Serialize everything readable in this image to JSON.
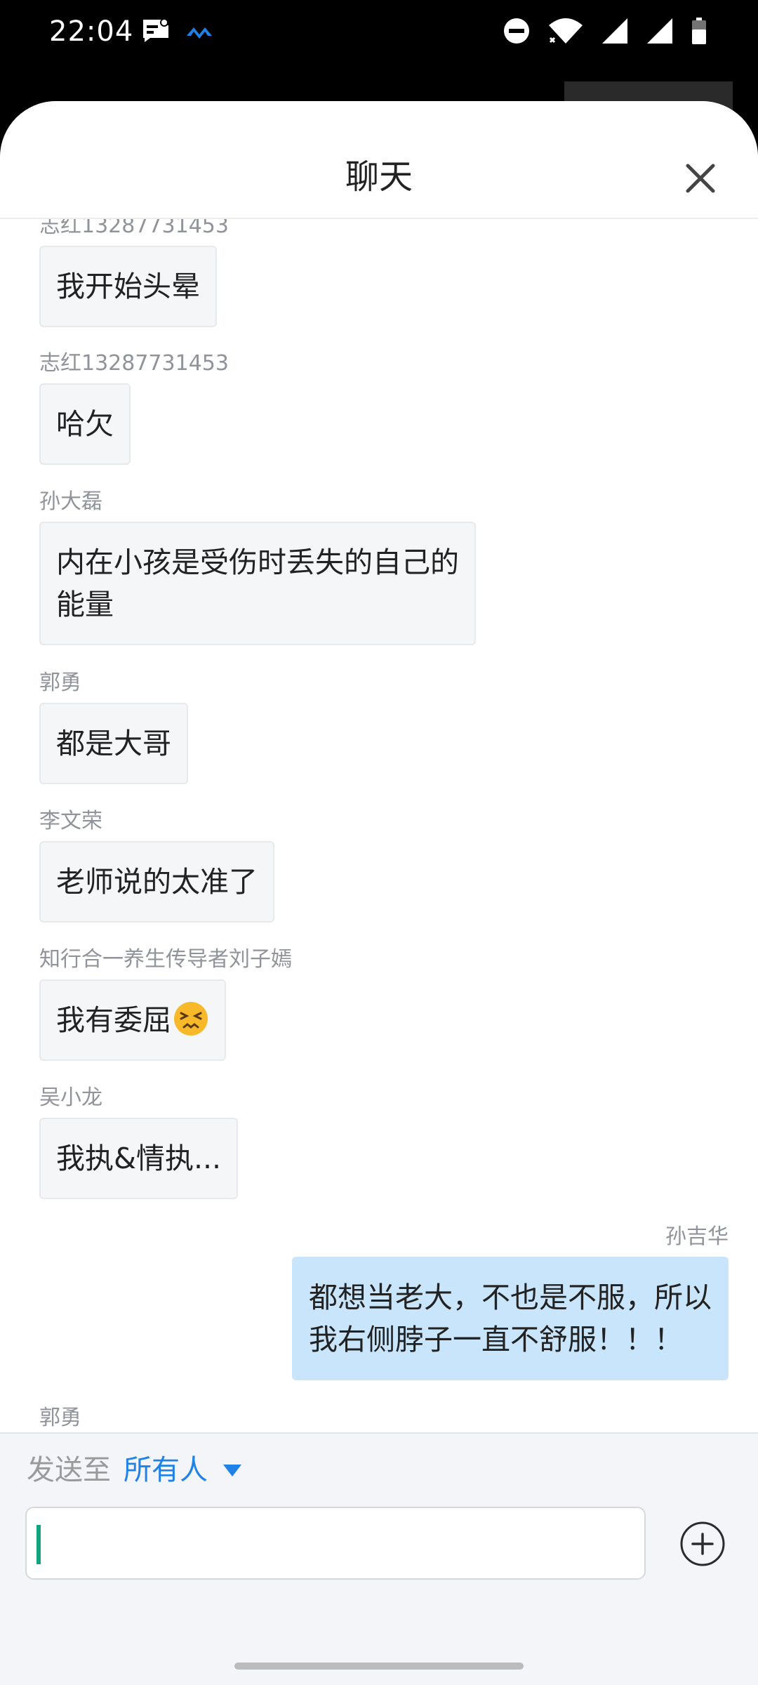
{
  "status_bar": {
    "time": "22:04",
    "icons": [
      "message-alert-icon",
      "cloud-sync-icon",
      "do-not-disturb-icon",
      "wifi-icon",
      "signal-icon",
      "signal-icon",
      "battery-icon"
    ]
  },
  "header": {
    "title": "聊天",
    "close_icon": "close-icon"
  },
  "messages": [
    {
      "sender": "志红13287731453",
      "text": "我开始头晕",
      "side": "left"
    },
    {
      "sender": "志红13287731453",
      "text": "哈欠",
      "side": "left"
    },
    {
      "sender": "孙大磊",
      "text": "内在小孩是受伤时丢失的自己的\n能量",
      "side": "left"
    },
    {
      "sender": "郭勇",
      "text": "都是大哥",
      "side": "left"
    },
    {
      "sender": "李文荣",
      "text": "老师说的太准了",
      "side": "left"
    },
    {
      "sender": "知行合一养生传导者刘子嫣",
      "text": "我有委屈",
      "emoji": "persevering-face-emoji",
      "side": "left"
    },
    {
      "sender": "吴小龙",
      "text": "我执&情执...",
      "side": "left"
    },
    {
      "sender": "孙吉华",
      "text": "都想当老大，不也是不服，所以\n我右侧脖子一直不舒服！！！",
      "side": "right"
    },
    {
      "sender": "郭勇",
      "text": "",
      "side": "left"
    }
  ],
  "composer": {
    "send_to_label": "发送至",
    "send_to_target": "所有人",
    "input_value": "",
    "add_icon": "plus-circle-icon"
  },
  "colors": {
    "accent": "#1f82e9",
    "own_bubble": "#c9e5fb",
    "other_bubble": "#f5f6f8",
    "cursor": "#14a37f"
  }
}
